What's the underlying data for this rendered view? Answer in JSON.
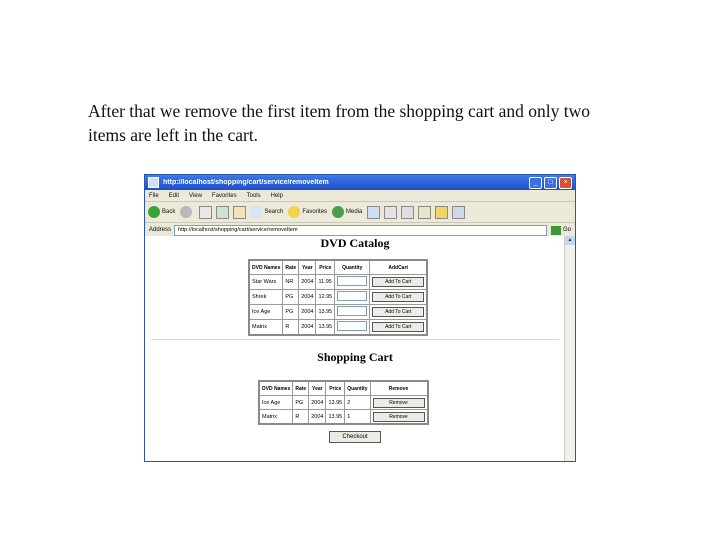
{
  "caption": {
    "line1": "After that we remove the first item from the shopping cart and only two",
    "line2": "items are left in the cart."
  },
  "browser": {
    "title": "http://localhost/shopping/cart/service/removeItem",
    "menu": [
      "File",
      "Edit",
      "View",
      "Favorites",
      "Tools",
      "Help"
    ],
    "toolbar": {
      "back": "Back",
      "search": "Search",
      "favorites": "Favorites",
      "media": "Media"
    },
    "address_label": "Address",
    "address": "http://localhost/shopping/cart/service/removeItem",
    "go_label": "Go"
  },
  "catalog": {
    "title": "DVD Catalog",
    "headers": [
      "DVD Names",
      "Rate",
      "Year",
      "Price",
      "Quantity",
      "AddCart"
    ],
    "rows": [
      [
        "Star Wars",
        "NR",
        "2004",
        "11.95"
      ],
      [
        "Shrek",
        "PG",
        "2004",
        "12.95"
      ],
      [
        "Ice Age",
        "PG",
        "2004",
        "13.95"
      ],
      [
        "Matrix",
        "R",
        "2004",
        "13.95"
      ]
    ],
    "button_label": "Add To Cart"
  },
  "cart": {
    "title": "Shopping Cart",
    "headers": [
      "DVD Names",
      "Rate",
      "Year",
      "Price",
      "Quantity",
      "Remove"
    ],
    "rows": [
      [
        "Ice Age",
        "PG",
        "2004",
        "13.95",
        "2"
      ],
      [
        "Matrix",
        "R",
        "2004",
        "13.95",
        "1"
      ]
    ],
    "button_label": "Remove",
    "checkout_label": "Checkout"
  }
}
